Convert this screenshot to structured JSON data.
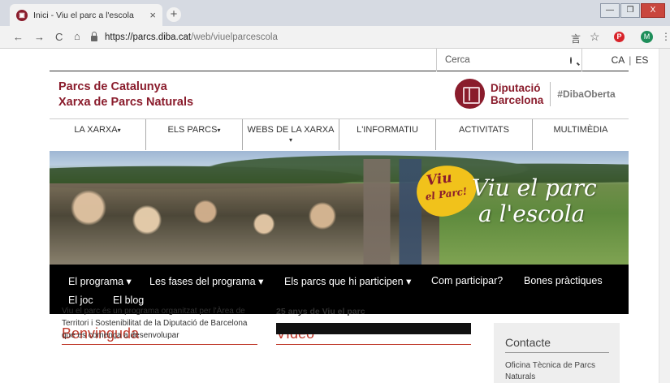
{
  "browser": {
    "tab_title": "Inici - Viu el parc a l'escola",
    "tab_close": "×",
    "new_tab": "+",
    "url_host": "https://parcs.diba.cat",
    "url_path": "/web/viuelparcescola",
    "back": "←",
    "forward": "→",
    "reload": "C",
    "home": "⌂",
    "translate": "⾔",
    "star": "☆",
    "pinterest": "P",
    "avatar_letter": "M",
    "menu": "⋮",
    "win_min": "—",
    "win_max": "❐",
    "win_close": "X"
  },
  "header": {
    "search_placeholder": "Cerca",
    "lang_ca": "CA",
    "lang_sep": "|",
    "lang_es": "ES",
    "brand_line1": "Parcs de Catalunya",
    "brand_line2": "Xarxa de Parcs Naturals",
    "dipu_line1": "Diputació",
    "dipu_line2": "Barcelona",
    "hashtag": "#DibaOberta"
  },
  "main_nav": [
    {
      "label": "LA XARXA",
      "caret": "▾"
    },
    {
      "label": "ELS PARCS",
      "caret": "▾"
    },
    {
      "label": "WEBS DE LA XARXA",
      "caret": "▾"
    },
    {
      "label": "L'INFORMATIU",
      "caret": ""
    },
    {
      "label": "ACTIVITATS",
      "caret": ""
    },
    {
      "label": "MULTIMÈDIA",
      "caret": ""
    }
  ],
  "hero": {
    "badge_line1": "Viu",
    "badge_line2": "el Parc!",
    "title_line1": "Viu el parc",
    "title_line2": "a l'escola"
  },
  "sub_nav": [
    {
      "label": "El programa ▾"
    },
    {
      "label": "Les fases del programa ▾"
    },
    {
      "label": "Els parcs que hi participen ▾"
    },
    {
      "label": "Com participar?"
    },
    {
      "label": "Bones pràctiques"
    },
    {
      "label": "El joc"
    },
    {
      "label": "El blog"
    }
  ],
  "welcome": {
    "title": "Benvinguda",
    "text": "Viu el parc és un programa organitzat per l'Àrea de Territori i Sostenibilitat de la Diputació de Barcelona que es comença a desenvolupar"
  },
  "video": {
    "title": "Vídeo",
    "subtitle": "25 anys de Viu el parc"
  },
  "contact": {
    "title": "Contacte",
    "text": "Oficina Tècnica de Parcs Naturals"
  },
  "colors": {
    "brand": "#8a1c2c",
    "accent_red": "#c0392b",
    "subnav_bg": "#000000",
    "badge_yellow": "#f1c21b"
  }
}
